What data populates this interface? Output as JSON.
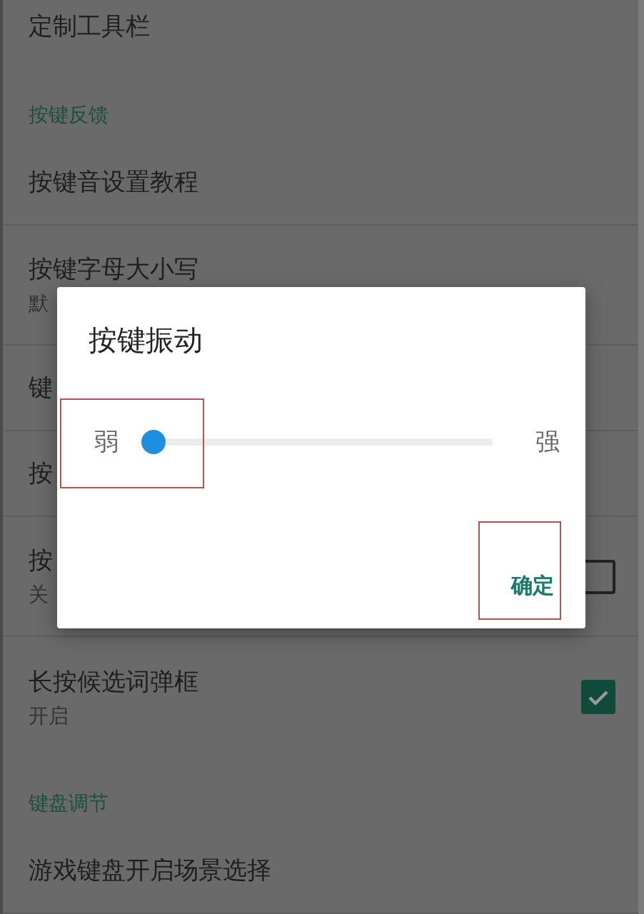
{
  "settings": [
    {
      "kind": "item",
      "title": "定制工具栏"
    },
    {
      "kind": "header",
      "title": "按键反馈"
    },
    {
      "kind": "item",
      "title": "按键音设置教程"
    },
    {
      "kind": "item",
      "title": "按键字母大小写",
      "subtitle": "默"
    },
    {
      "kind": "item",
      "title": "键"
    },
    {
      "kind": "item",
      "title": "按"
    },
    {
      "kind": "item",
      "title": "按",
      "subtitle": "关",
      "checked": false
    },
    {
      "kind": "item",
      "title": "长按候选词弹框",
      "subtitle": "开启",
      "checked": true
    },
    {
      "kind": "header",
      "title": "键盘调节"
    },
    {
      "kind": "item",
      "title": "游戏键盘开启场景选择"
    }
  ],
  "dialog": {
    "title": "按键振动",
    "slider": {
      "min_label": "弱",
      "max_label": "强",
      "level": 0
    },
    "button": "确定"
  }
}
